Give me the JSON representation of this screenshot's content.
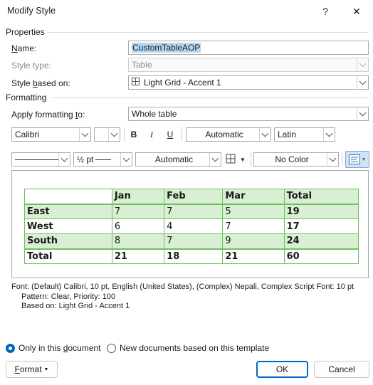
{
  "window": {
    "title": "Modify Style",
    "help_glyph": "?",
    "close_glyph": "✕"
  },
  "properties": {
    "section": "Properties",
    "name_label": "Name:",
    "name_value": "CustomTableAOP",
    "type_label": "Style type:",
    "type_value": "Table",
    "based_label": "Style based on:",
    "based_value": "Light Grid - Accent 1"
  },
  "formatting": {
    "section": "Formatting",
    "apply_label": "Apply formatting to:",
    "apply_value": "Whole table",
    "font": "Calibri",
    "font_size": "",
    "bold": "B",
    "italic": "I",
    "underline": "U",
    "color": "Automatic",
    "script": "Latin",
    "border_width": "½ pt",
    "border_color": "Automatic",
    "shading": "No Color"
  },
  "preview": {
    "header": [
      "",
      "Jan",
      "Feb",
      "Mar",
      "Total"
    ],
    "rows": [
      [
        "East",
        "7",
        "7",
        "5",
        "19"
      ],
      [
        "West",
        "6",
        "4",
        "7",
        "17"
      ],
      [
        "South",
        "8",
        "7",
        "9",
        "24"
      ]
    ],
    "total": [
      "Total",
      "21",
      "18",
      "21",
      "60"
    ],
    "accent": "#6fbf60",
    "band": "#d8efd3"
  },
  "description": {
    "line1": "Font: (Default) Calibri, 10 pt, English (United States), (Complex) Nepali, Complex Script Font: 10 pt",
    "line2": "Pattern: Clear, Priority: 100",
    "line3": "Based on: Light Grid - Accent 1"
  },
  "options": {
    "only_doc": "Only in this document",
    "new_docs": "New documents based on this template"
  },
  "buttons": {
    "format": "Format",
    "ok": "OK",
    "cancel": "Cancel"
  }
}
